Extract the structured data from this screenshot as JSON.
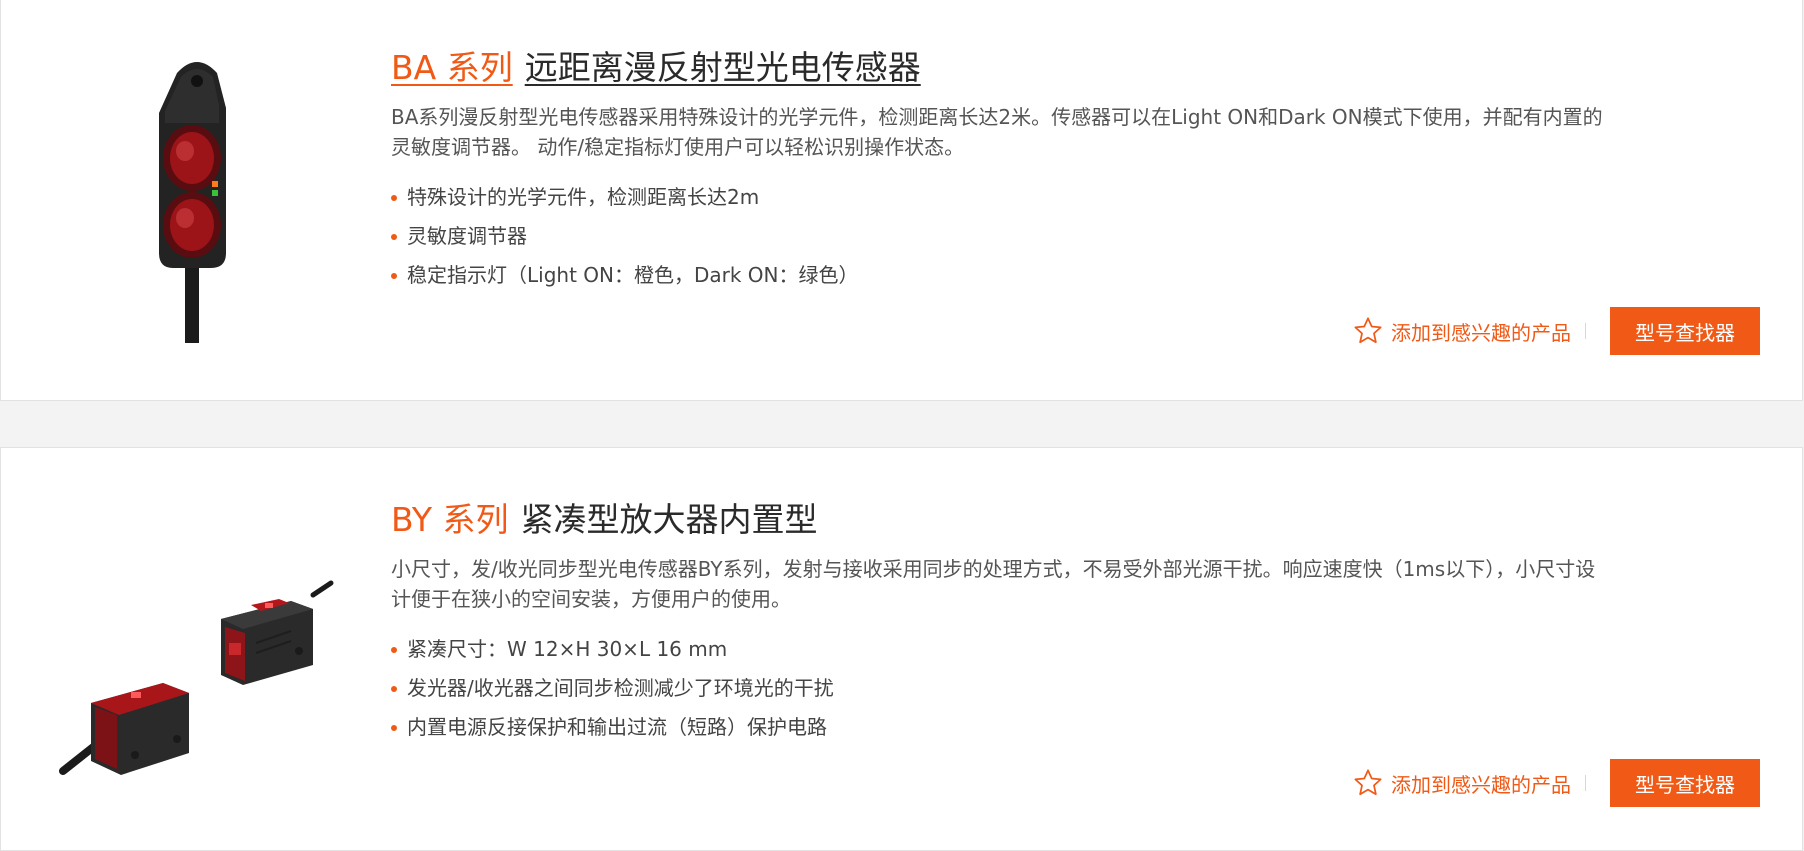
{
  "colors": {
    "accent": "#f05a16",
    "card_bg": "#ffffff",
    "page_bg": "#f3f3f3"
  },
  "products": [
    {
      "series": "BA 系列",
      "name": "远距离漫反射型光电传感器",
      "description": "BA系列漫反射型光电传感器采用特殊设计的光学元件，检测距离长达2米。传感器可以在Light ON和Dark ON模式下使用，并配有内置的灵敏度调节器。 动作/稳定指标灯使用户可以轻松识别操作状态。",
      "features": [
        "特殊设计的光学元件，检测距离长达2m",
        "灵敏度调节器",
        "稳定指示灯（Light ON：橙色，Dark ON：绿色）"
      ],
      "favorite_label": "添加到感兴趣的产品",
      "finder_label": "型号查找器",
      "icon": "star-icon"
    },
    {
      "series": "BY 系列",
      "name": "紧凑型放大器内置型",
      "description": "小尺寸，发/收光同步型光电传感器BY系列，发射与接收采用同步的处理方式，不易受外部光源干扰。响应速度快（1ms以下），小尺寸设计便于在狭小的空间安装，方便用户的使用。",
      "features": [
        "紧凑尺寸：W 12×H 30×L 16 mm",
        "发光器/收光器之间同步检测减少了环境光的干扰",
        "内置电源反接保护和输出过流（短路）保护电路"
      ],
      "favorite_label": "添加到感兴趣的产品",
      "finder_label": "型号查找器",
      "icon": "star-icon"
    }
  ]
}
